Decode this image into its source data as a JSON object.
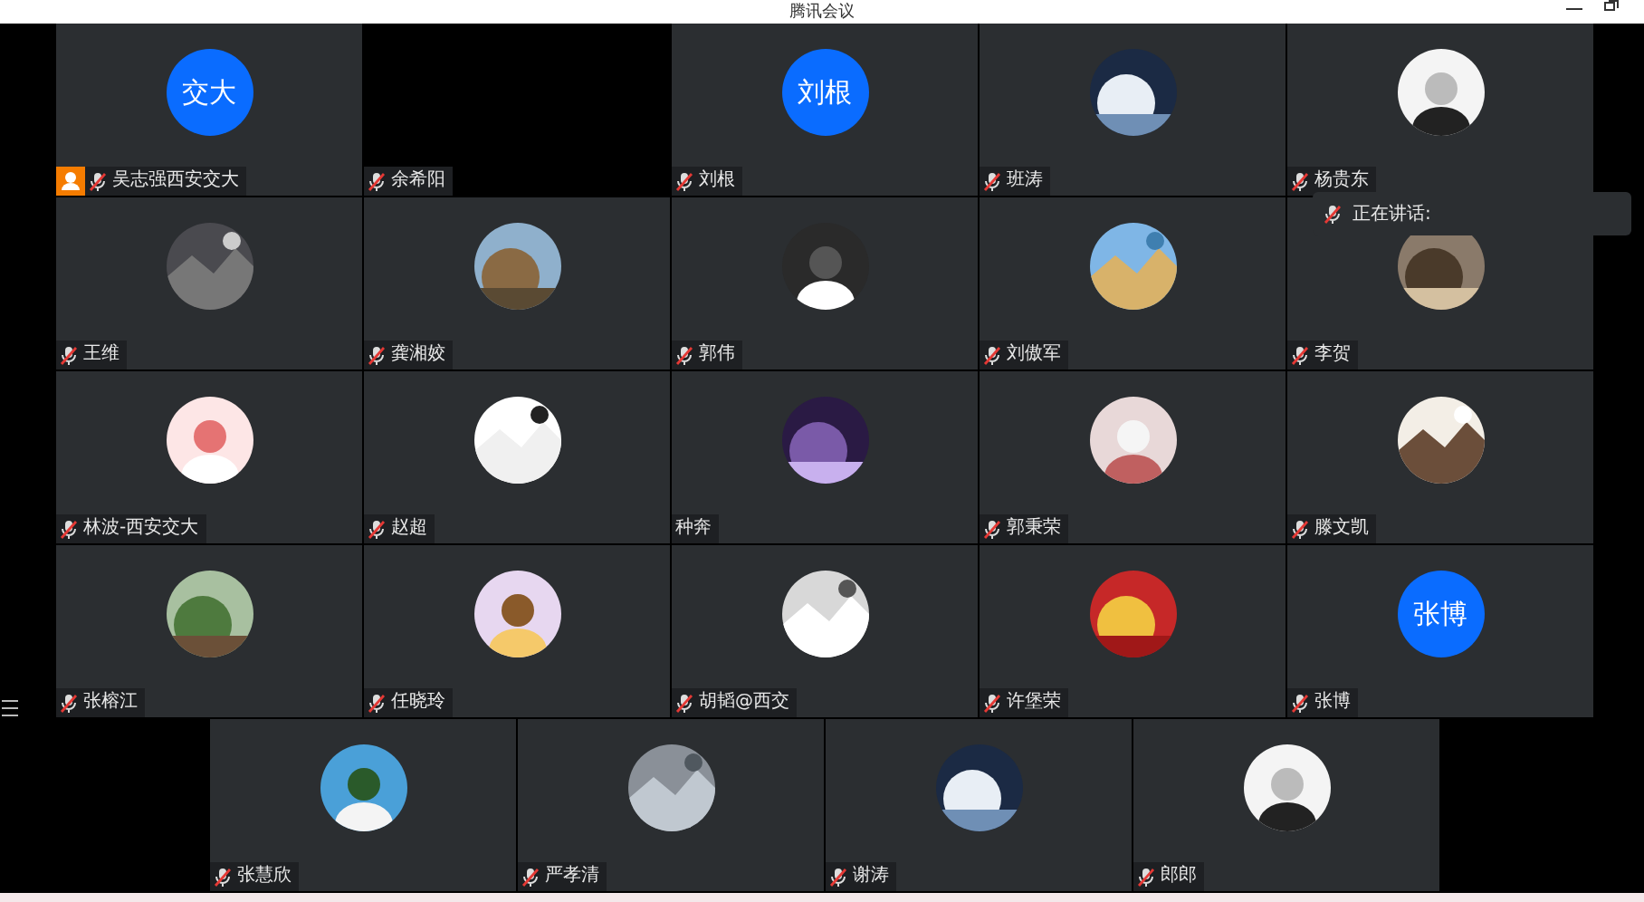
{
  "window": {
    "title": "腾讯会议"
  },
  "rows": [
    [
      {
        "kind": "initials",
        "avatar_text": "交大",
        "name": "吴志强西安交大",
        "muted": true,
        "host": true
      },
      {
        "kind": "video",
        "name": "余希阳",
        "muted": true,
        "host": false
      },
      {
        "kind": "initials",
        "avatar_text": "刘根",
        "name": "刘根",
        "muted": true,
        "host": false
      },
      {
        "kind": "picture",
        "name": "班涛",
        "muted": true,
        "host": false
      },
      {
        "kind": "picture",
        "name": "杨贵东",
        "muted": true,
        "host": false
      }
    ],
    [
      {
        "kind": "picture",
        "name": "王维",
        "muted": true,
        "host": false
      },
      {
        "kind": "picture",
        "name": "龚湘姣",
        "muted": true,
        "host": false
      },
      {
        "kind": "picture",
        "name": "郭伟",
        "muted": true,
        "host": false
      },
      {
        "kind": "picture",
        "name": "刘傲军",
        "muted": true,
        "host": false
      },
      {
        "kind": "picture",
        "name": "李贺",
        "muted": true,
        "host": false
      }
    ],
    [
      {
        "kind": "picture",
        "name": "林波-西安交大",
        "muted": true,
        "host": false
      },
      {
        "kind": "picture",
        "name": "赵超",
        "muted": true,
        "host": false
      },
      {
        "kind": "picture",
        "name": "种奔",
        "muted": false,
        "host": false
      },
      {
        "kind": "picture",
        "name": "郭秉荣",
        "muted": true,
        "host": false
      },
      {
        "kind": "picture",
        "name": "滕文凯",
        "muted": true,
        "host": false
      }
    ],
    [
      {
        "kind": "picture",
        "name": "张榕江",
        "muted": true,
        "host": false
      },
      {
        "kind": "picture",
        "name": "任晓玲",
        "muted": true,
        "host": false
      },
      {
        "kind": "picture",
        "name": "胡韬@西交",
        "muted": true,
        "host": false
      },
      {
        "kind": "picture",
        "name": "许堡荣",
        "muted": true,
        "host": false
      },
      {
        "kind": "initials",
        "avatar_text": "张博",
        "name": "张博",
        "muted": true,
        "host": false
      }
    ],
    [
      {
        "kind": "picture",
        "name": "张慧欣",
        "muted": true,
        "host": false
      },
      {
        "kind": "picture",
        "name": "严孝清",
        "muted": true,
        "host": false
      },
      {
        "kind": "picture",
        "name": "谢涛",
        "muted": true,
        "host": false
      },
      {
        "kind": "picture",
        "name": "郎郎",
        "muted": true,
        "host": false
      }
    ]
  ],
  "speaking": {
    "label": "正在讲话:",
    "muted": true
  }
}
